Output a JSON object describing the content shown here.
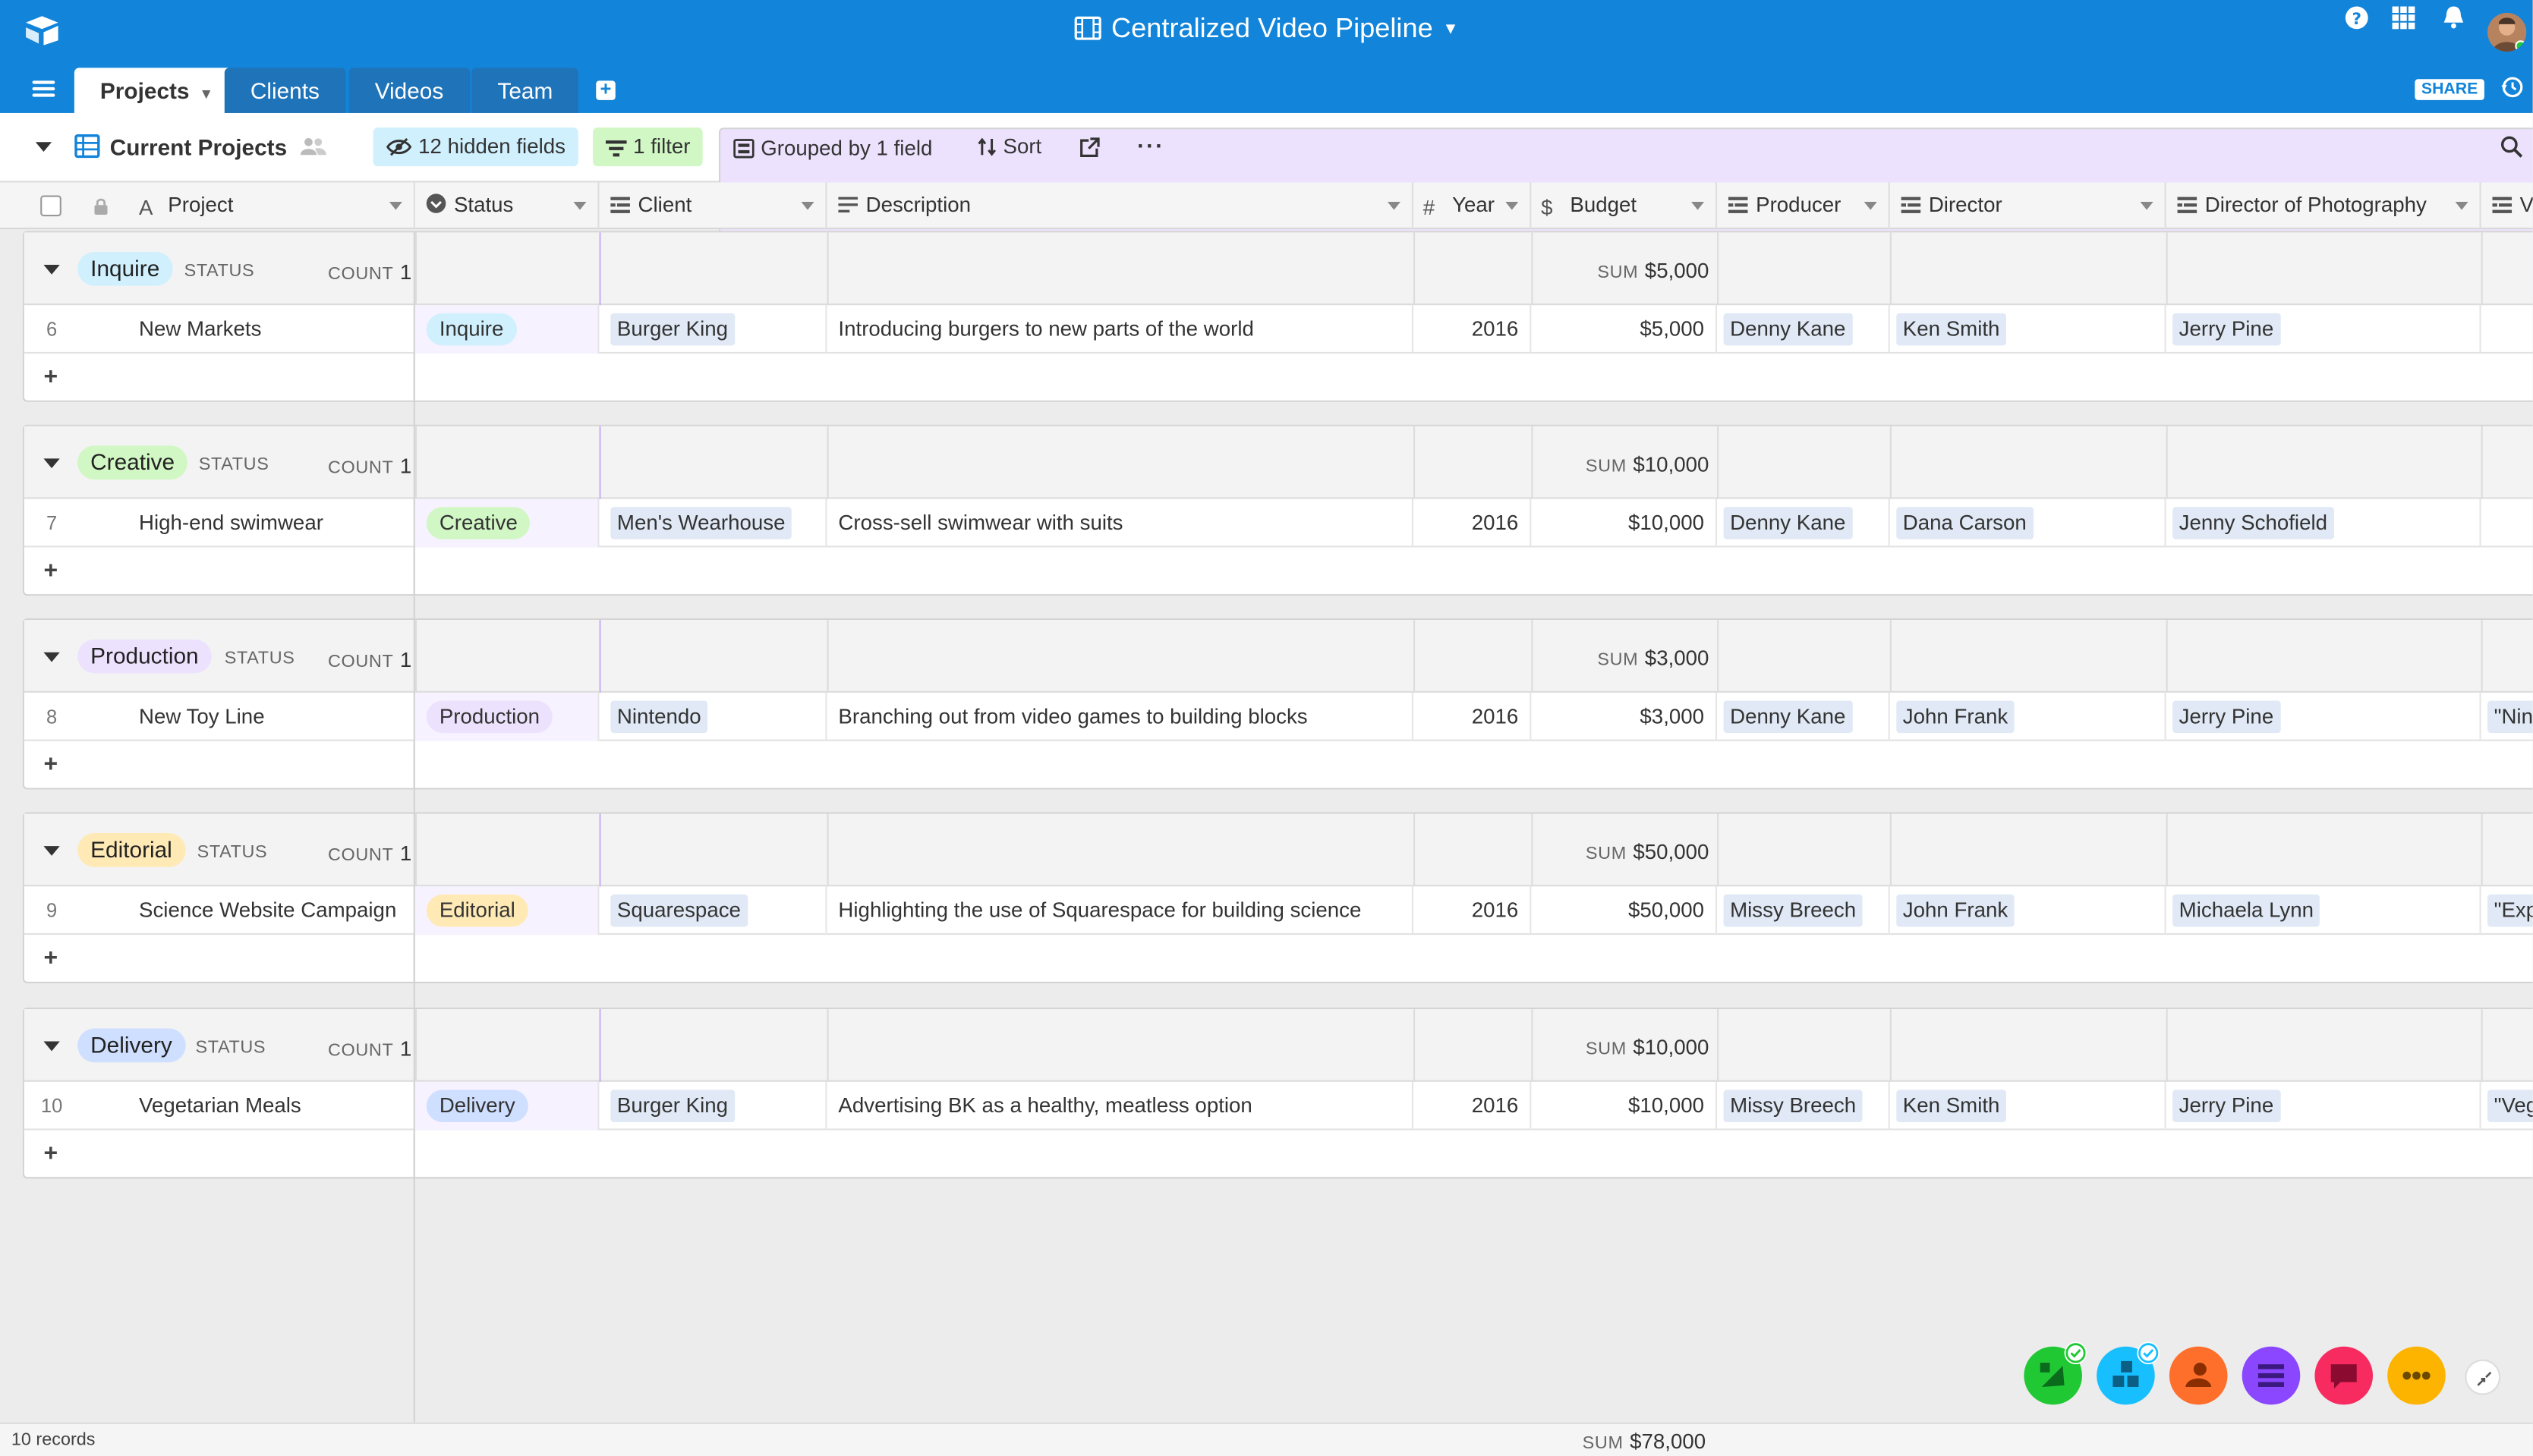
{
  "app": {
    "base_title": "Centralized Video Pipeline",
    "share_label": "SHARE"
  },
  "tabs": [
    {
      "label": "Projects"
    },
    {
      "label": "Clients"
    },
    {
      "label": "Videos"
    },
    {
      "label": "Team"
    }
  ],
  "view": {
    "name": "Current Projects",
    "hidden_fields": "12 hidden fields",
    "filter": "1 filter",
    "grouped": "Grouped by 1 field",
    "sort": "Sort",
    "more": "···"
  },
  "columns": {
    "project": "Project",
    "status": "Status",
    "client": "Client",
    "description": "Description",
    "year": "Year",
    "budget": "Budget",
    "producer": "Producer",
    "director": "Director",
    "dop": "Director of Photography",
    "next": "V"
  },
  "group_meta": {
    "status_label": "STATUS",
    "count_label": "COUNT",
    "sum_label": "SUM",
    "add_symbol": "+"
  },
  "groups": [
    {
      "status": "Inquire",
      "count": "1",
      "sum": "$5,000",
      "row": {
        "num": "6",
        "project": "New Markets",
        "status": "Inquire",
        "client": "Burger King",
        "description": "Introducing burgers to new parts of the world",
        "year": "2016",
        "budget": "$5,000",
        "producer": "Denny Kane",
        "director": "Ken Smith",
        "dop": "Jerry Pine",
        "next": ""
      }
    },
    {
      "status": "Creative",
      "count": "1",
      "sum": "$10,000",
      "row": {
        "num": "7",
        "project": "High-end swimwear",
        "status": "Creative",
        "client": "Men's Wearhouse",
        "description": "Cross-sell swimwear with suits",
        "year": "2016",
        "budget": "$10,000",
        "producer": "Denny Kane",
        "director": "Dana Carson",
        "dop": "Jenny Schofield",
        "next": ""
      }
    },
    {
      "status": "Production",
      "count": "1",
      "sum": "$3,000",
      "row": {
        "num": "8",
        "project": "New Toy Line",
        "status": "Production",
        "client": "Nintendo",
        "description": "Branching out from video games to building blocks",
        "year": "2016",
        "budget": "$3,000",
        "producer": "Denny Kane",
        "director": "John Frank",
        "dop": "Jerry Pine",
        "next": "\"Nin"
      }
    },
    {
      "status": "Editorial",
      "count": "1",
      "sum": "$50,000",
      "row": {
        "num": "9",
        "project": "Science Website Campaign",
        "status": "Editorial",
        "client": "Squarespace",
        "description": "Highlighting the use of Squarespace for building science",
        "year": "2016",
        "budget": "$50,000",
        "producer": "Missy Breech",
        "director": "John Frank",
        "dop": "Michaela Lynn",
        "next": "\"Exp"
      }
    },
    {
      "status": "Delivery",
      "count": "1",
      "sum": "$10,000",
      "row": {
        "num": "10",
        "project": "Vegetarian Meals",
        "status": "Delivery",
        "client": "Burger King",
        "description": "Advertising BK as a healthy, meatless option",
        "year": "2016",
        "budget": "$10,000",
        "producer": "Missy Breech",
        "director": "Ken Smith",
        "dop": "Jerry Pine",
        "next": "\"Veg"
      }
    }
  ],
  "footer": {
    "records": "10 records",
    "sum_label": "SUM",
    "total": "$78,000"
  },
  "colors": {
    "topbar": "#1284d9",
    "inquire": "#d0f0fd",
    "creative": "#d1f7c4",
    "production": "#ede2fe",
    "editorial": "#ffeab6",
    "delivery": "#cfdfff"
  },
  "icons": {
    "apps": [
      "page-designer-app-icon",
      "blocks-app-icon",
      "contact-app-icon",
      "list-app-icon",
      "chat-app-icon",
      "more-apps-icon"
    ]
  }
}
